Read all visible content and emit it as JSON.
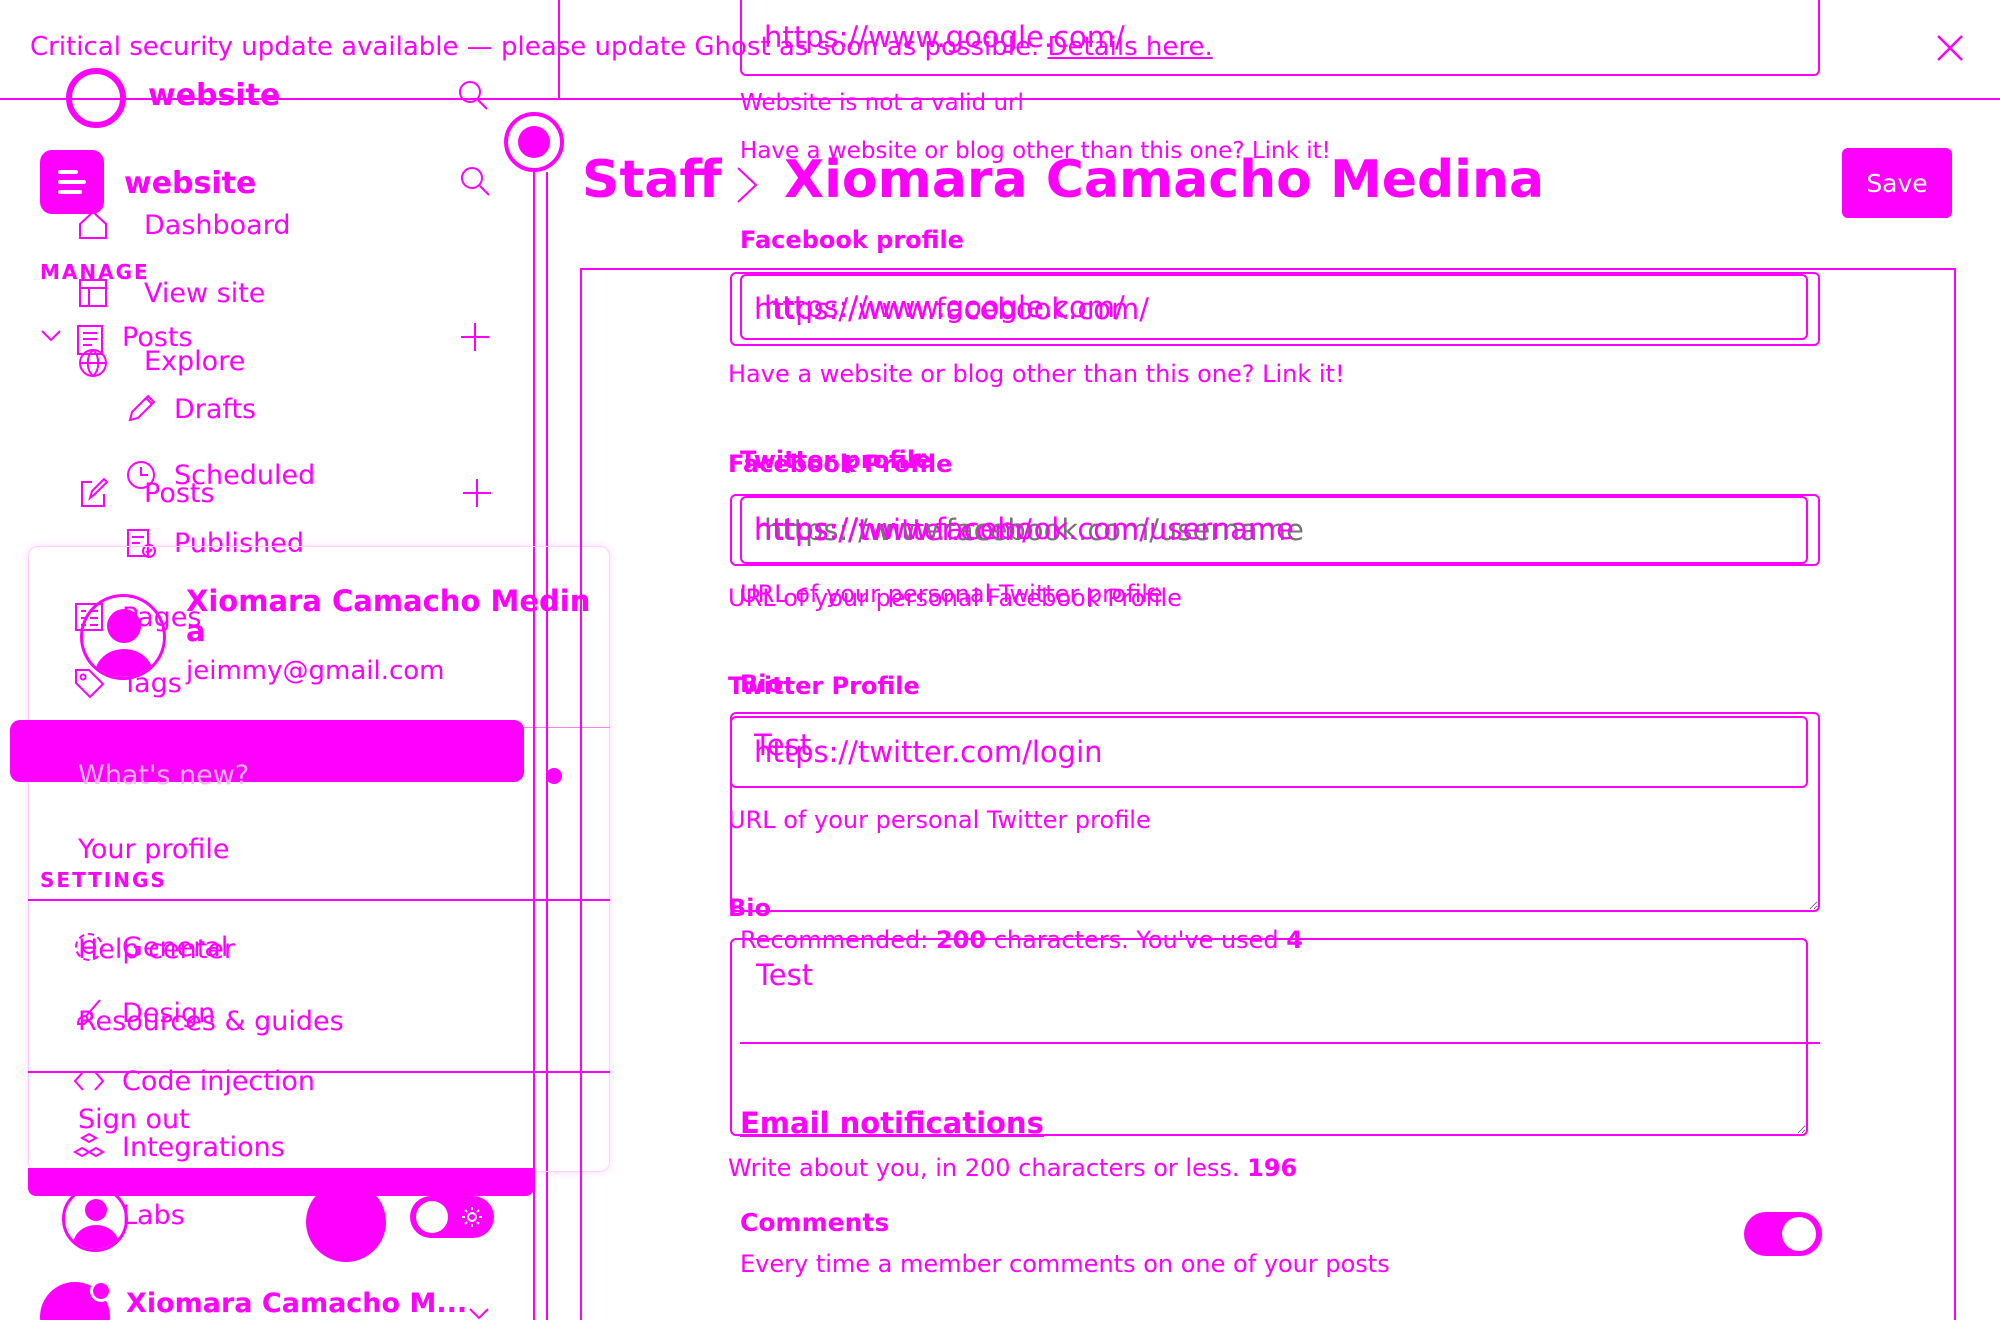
{
  "banner": {
    "text": "Critical security update available — please update Ghost as soon as possible.",
    "link": "Details here."
  },
  "brand": {
    "name": "website"
  },
  "sidebar": {
    "sections": {
      "manage": "MANAGE",
      "settings": "SETTINGS"
    },
    "items": {
      "dashboard": "Dashboard",
      "view_site": "View site",
      "explore": "Explore",
      "posts": "Posts",
      "drafts": "Drafts",
      "scheduled": "Scheduled",
      "published": "Published",
      "pages": "Pages",
      "tags": "Tags",
      "general": "General",
      "design": "Design",
      "code_injection": "Code injection",
      "integrations": "Integrations",
      "labs": "Labs"
    },
    "footer_user": "Xiomara Camacho M..."
  },
  "user_menu": {
    "name": "Xiomara Camacho Medina",
    "name_line1": "Xiomara Camacho Medin",
    "name_line2": "a",
    "email": "jeimmy@gmail.com",
    "whats_new": "What's new?",
    "your_profile": "Your profile",
    "help_center": "Help center",
    "resources": "Resources & guides",
    "sign_out": "Sign out"
  },
  "header": {
    "breadcrumb_root": "Staff",
    "title": "Xiomara Camacho Medina",
    "save": "Save"
  },
  "form": {
    "website_value": "https://www.google.com/",
    "website_error": "Website is not a valid url",
    "website_hint": "Have a website or blog other than this one? Link it!",
    "facebook_label": "Facebook profile",
    "facebook_label_alt": "Facebook Profile",
    "facebook_value": "https://www.facebook.com/",
    "facebook_placeholder": "https://www.facebook.com/username",
    "facebook_hint": "URL of your personal Facebook Profile",
    "twitter_label": "Twitter profile",
    "twitter_label_alt": "Twitter Profile",
    "twitter_value": "https://twitter.com/",
    "twitter_value_alt": "https://twitter.com/login",
    "twitter_placeholder": "https://twitter.com/username",
    "twitter_hint": "URL of your personal Twitter profile",
    "bio_label": "Bio",
    "bio_value": "Test",
    "bio_recommended_pre": "Recommended:",
    "bio_recommended_num": "200",
    "bio_recommended_mid": "characters. You've used",
    "bio_recommended_used": "4",
    "bio_hint_pre": "Write about you, in 200 characters or less.",
    "bio_hint_count": "196"
  },
  "email_notifications": {
    "title": "Email notifications",
    "comments_label": "Comments",
    "comments_desc": "Every time a member comments on one of your posts",
    "comments_enabled": true
  },
  "colors": {
    "accent": "#ff00ff",
    "background": "#ffffff"
  }
}
